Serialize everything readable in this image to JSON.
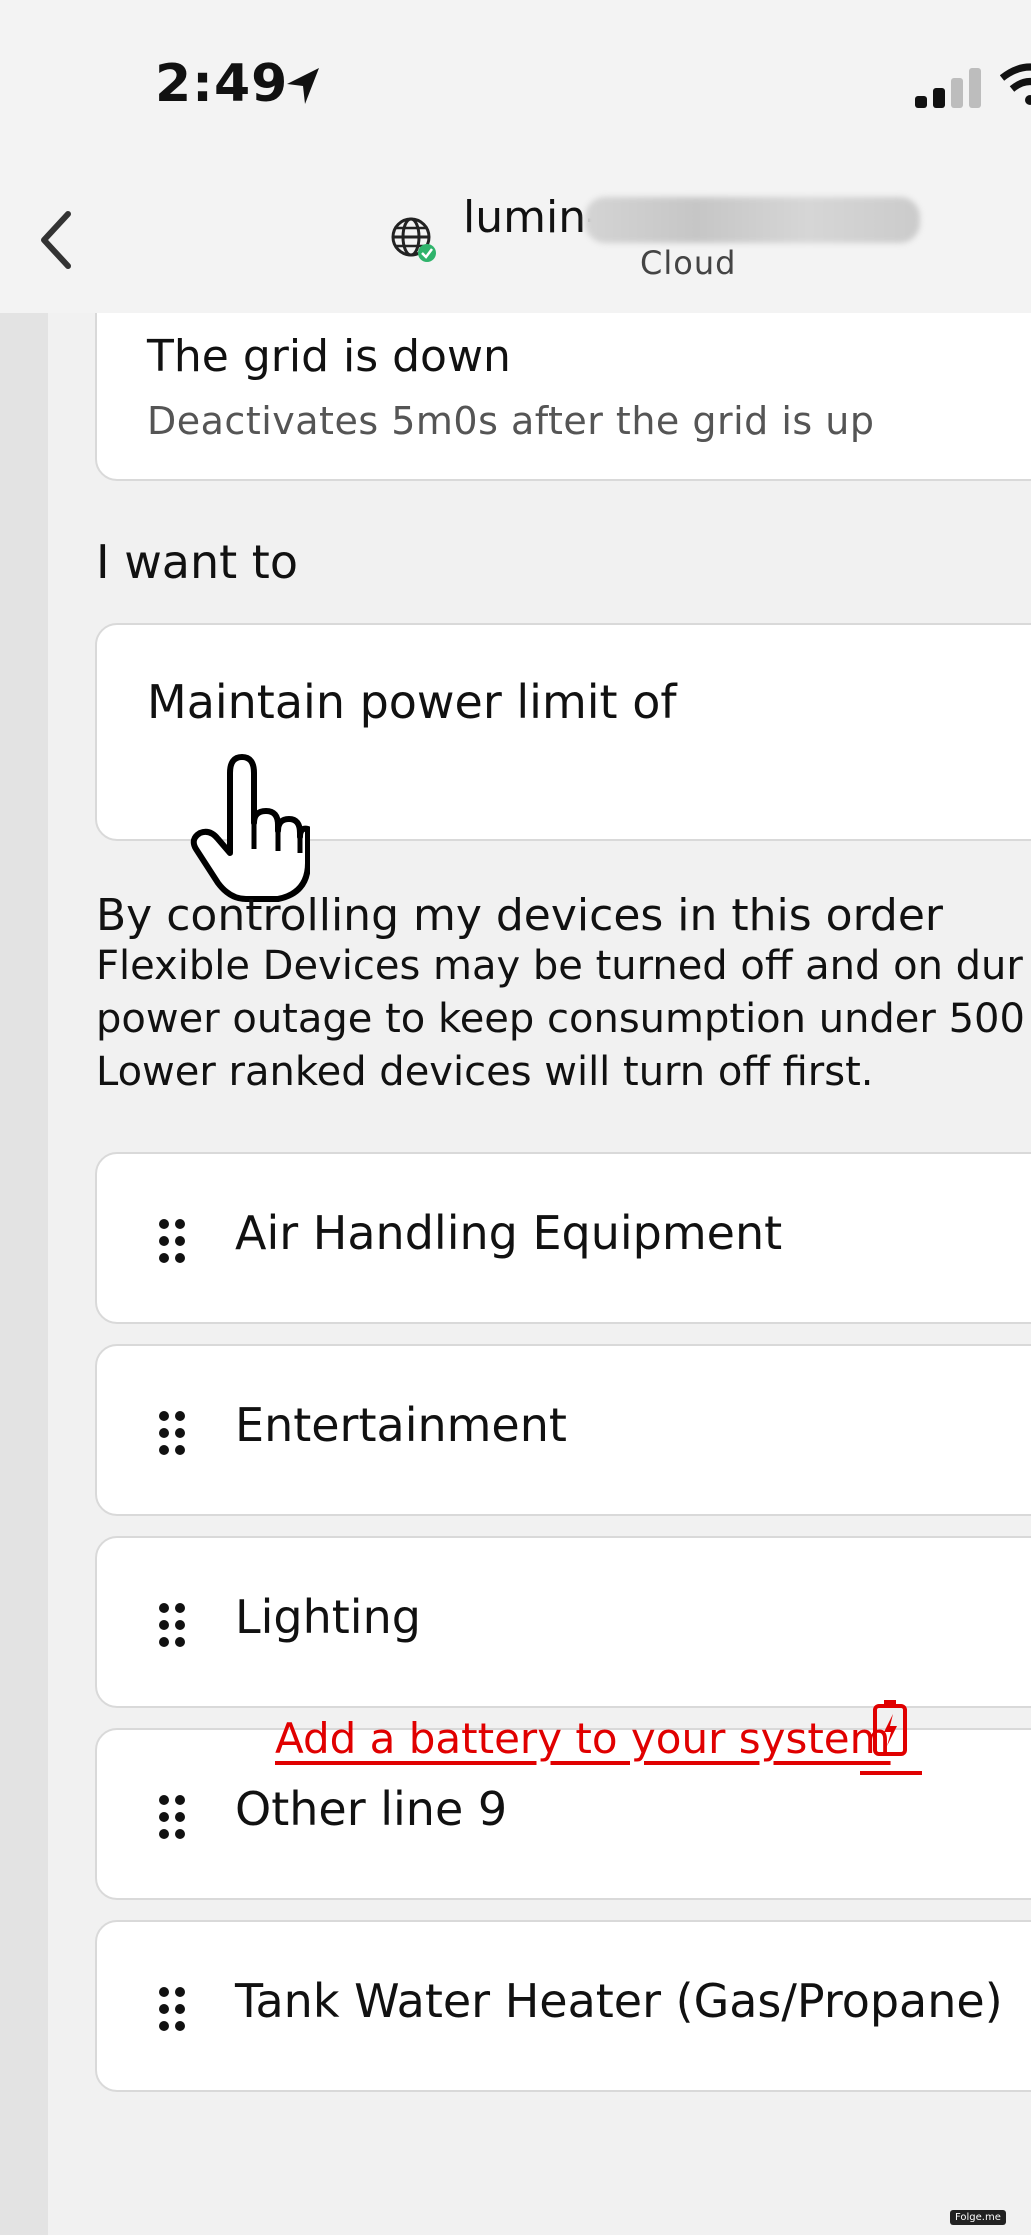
{
  "status_bar": {
    "time": "2:49"
  },
  "nav": {
    "site_prefix": "lumin-",
    "site_subtitle": "Cloud"
  },
  "trigger_card": {
    "title": "The grid is down",
    "subtitle": "Deactivates 5m0s after the grid is up"
  },
  "action_section": {
    "label": "I want to",
    "action_title": "Maintain power limit of"
  },
  "order_section": {
    "heading": "By controlling my devices in this order",
    "description_lines": [
      "Flexible Devices may be turned off and on dur",
      "power outage to keep consumption under 500",
      "Lower ranked devices will turn off first."
    ]
  },
  "devices": [
    {
      "label": "Air Handling Equipment"
    },
    {
      "label": "Entertainment"
    },
    {
      "label": "Lighting"
    },
    {
      "label": "Other line 9"
    },
    {
      "label": "Tank Water Heater (Gas/Propane)"
    }
  ],
  "footer": {
    "add_battery_link": "Add a battery to your system",
    "watermark": "Folge.me"
  },
  "colors": {
    "accent_red": "#e00000",
    "card_border": "#d9d9d9",
    "background": "#f1f1f1"
  },
  "icons": [
    "location-arrow-icon",
    "cellular-signal-icon",
    "wifi-icon",
    "back-chevron-icon",
    "globe-icon",
    "drag-handle-icon",
    "hand-pointer-cursor-icon",
    "battery-icon"
  ]
}
